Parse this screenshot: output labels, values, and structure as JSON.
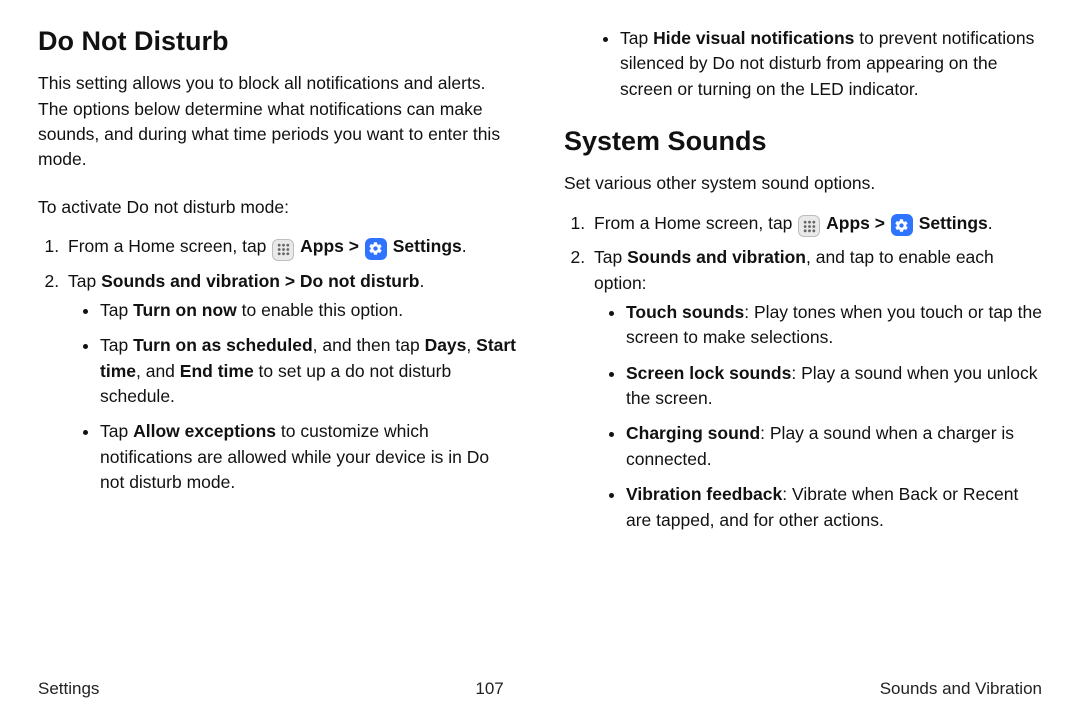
{
  "left": {
    "heading": "Do Not Disturb",
    "intro": "This setting allows you to block all notifications and alerts. The options below determine what notifications can make sounds, and during what time periods you want to enter this mode.",
    "lead": "To activate Do not disturb mode:",
    "step1_prefix": "From a Home screen, tap ",
    "apps_label": "Apps",
    "sep": " > ",
    "settings_label": "Settings",
    "step2_prefix": "Tap ",
    "step2_bold": "Sounds and vibration > Do not disturb",
    "b1_pre": "Tap ",
    "b1_bold": "Turn on now",
    "b1_post": " to enable this option.",
    "b2_pre": "Tap ",
    "b2_bold1": "Turn on as scheduled",
    "b2_mid1": ", and then tap ",
    "b2_bold2": "Days",
    "b2_mid2": ", ",
    "b2_bold3": "Start time",
    "b2_mid3": ", and ",
    "b2_bold4": "End time",
    "b2_post": " to set up a do not disturb schedule.",
    "b3_pre": "Tap ",
    "b3_bold": "Allow exceptions",
    "b3_post": " to customize which notifications are allowed while your device is in Do not disturb mode."
  },
  "right": {
    "top_pre": "Tap ",
    "top_bold": "Hide visual notifications",
    "top_post": " to prevent notifications silenced by Do not disturb from appearing on the screen or turning on the LED indicator.",
    "heading": "System Sounds",
    "intro": "Set various other system sound options.",
    "step1_prefix": "From a Home screen, tap ",
    "apps_label": "Apps",
    "sep": " > ",
    "settings_label": "Settings",
    "step2_pre": "Tap ",
    "step2_bold": "Sounds and vibration",
    "step2_post": ", and tap to enable each option:",
    "o1_bold": "Touch sounds",
    "o1_post": ": Play tones when you touch or tap the screen to make selections.",
    "o2_bold": "Screen lock sounds",
    "o2_post": ": Play a sound when you unlock the screen.",
    "o3_bold": "Charging sound",
    "o3_post": ": Play a sound when a charger is connected.",
    "o4_bold": "Vibration feedback",
    "o4_post": ": Vibrate when Back or Recent are tapped, and for other actions."
  },
  "footer": {
    "left": "Settings",
    "center": "107",
    "right": "Sounds and Vibration"
  }
}
